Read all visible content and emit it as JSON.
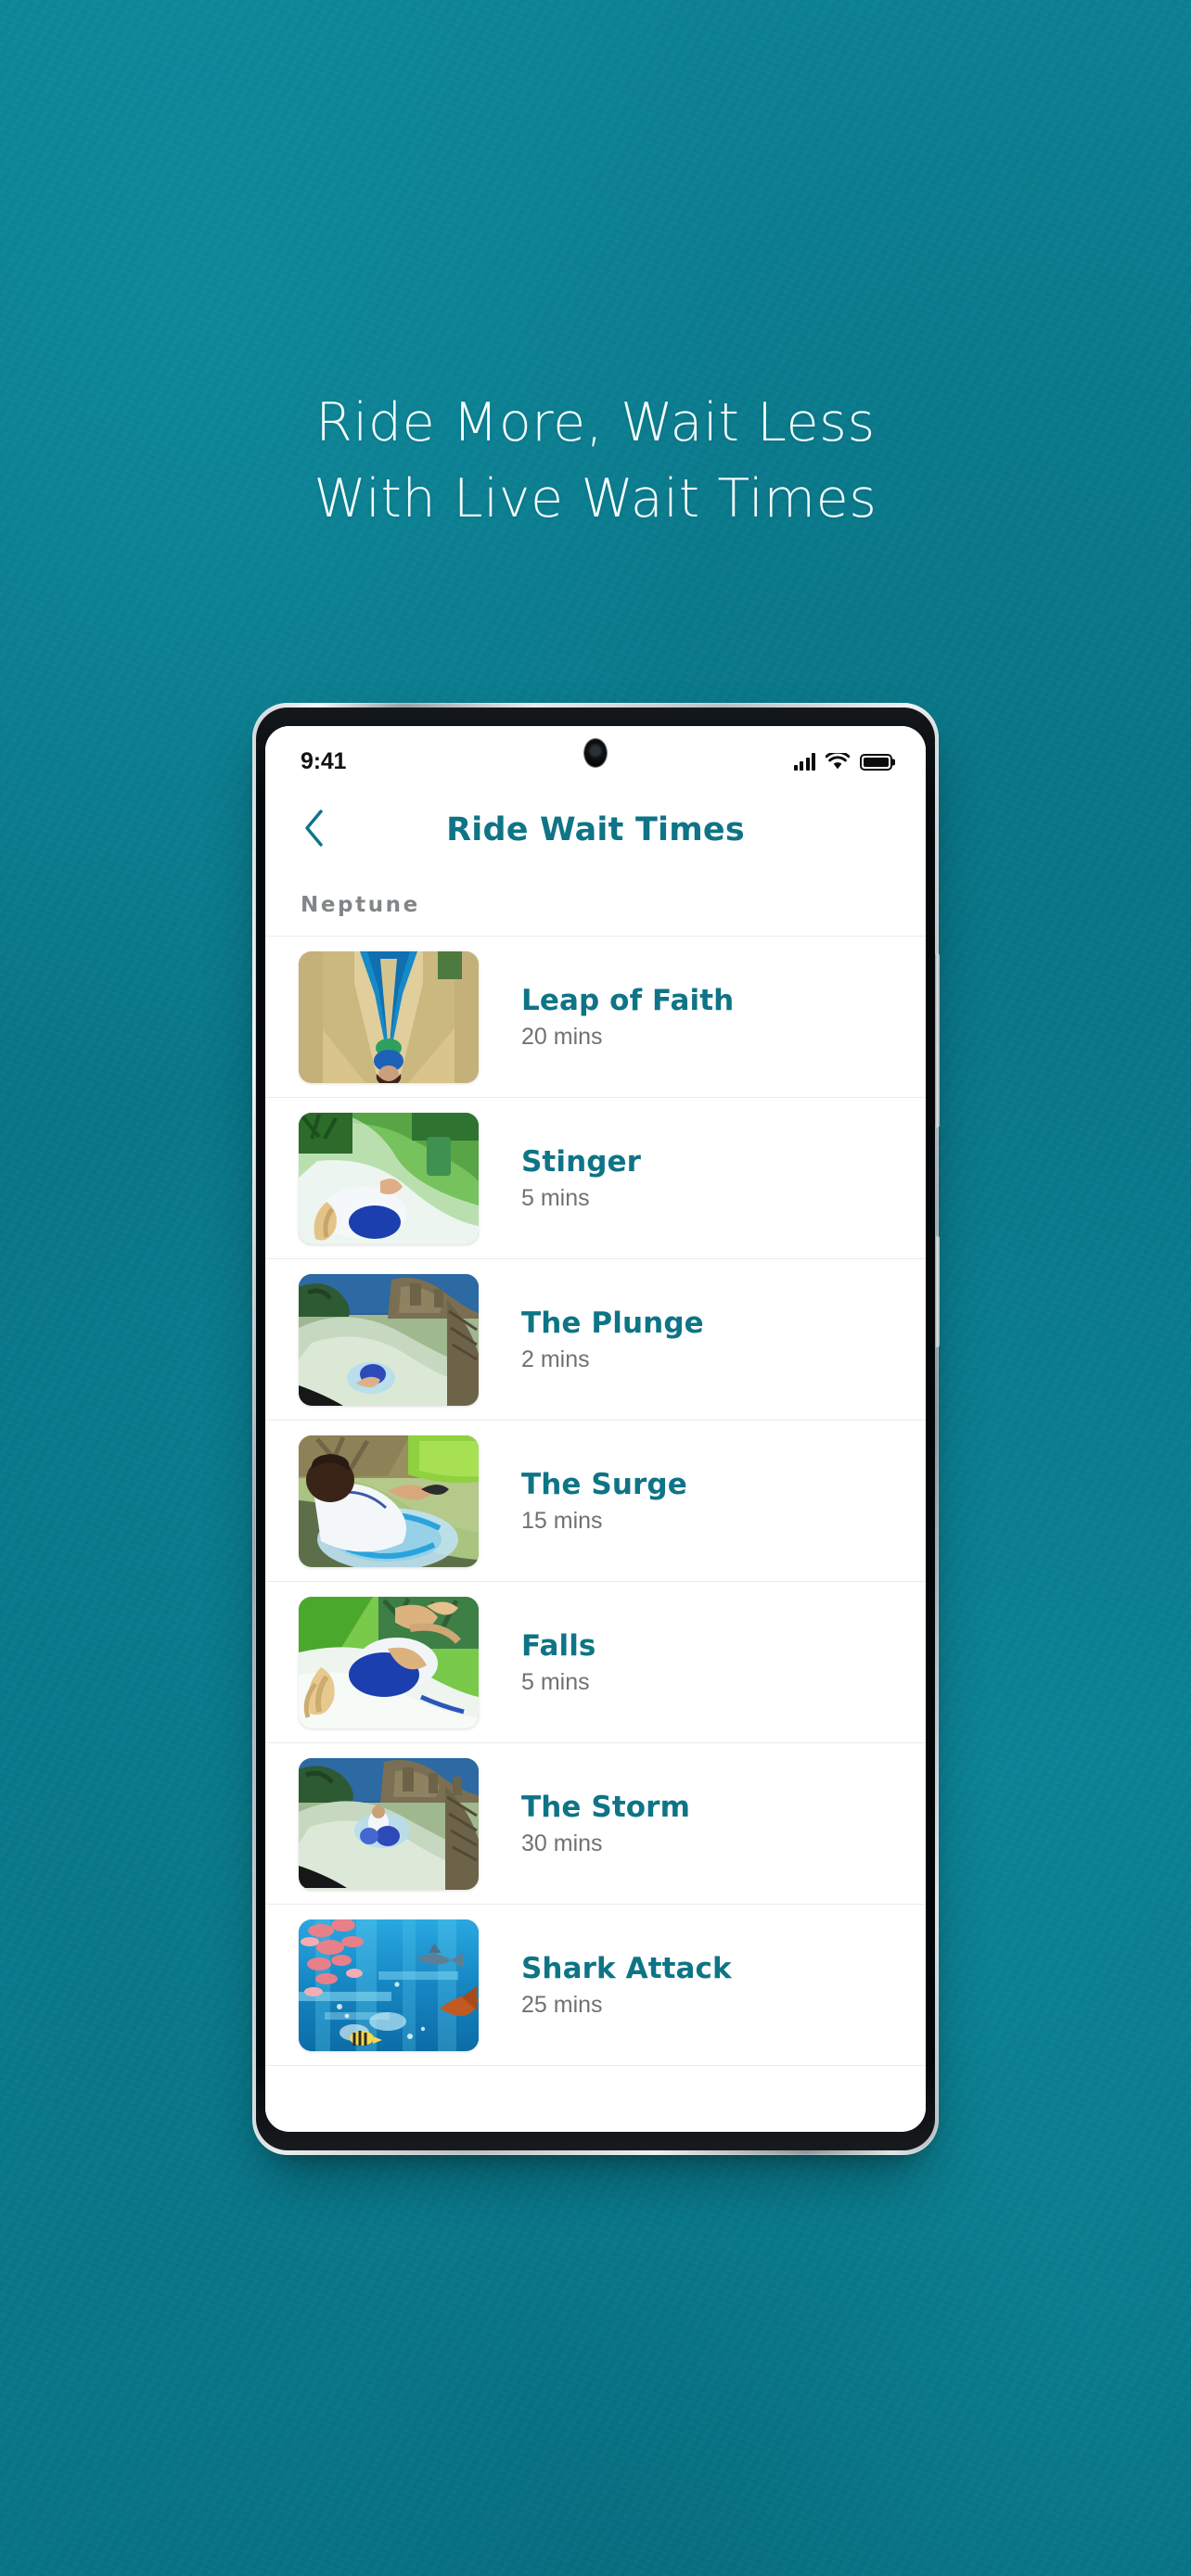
{
  "promo": {
    "headline_line1": "Ride More, Wait Less",
    "headline_line2": "With Live Wait Times",
    "background_color": "#0b7d8f",
    "headline_color": "#f2fbfc"
  },
  "status_bar": {
    "time": "9:41",
    "signal_icon": "cellular-signal-icon",
    "signal_bars": 4,
    "wifi_icon": "wifi-icon",
    "battery_icon": "battery-full-icon",
    "battery_level": 100
  },
  "header": {
    "title": "Ride Wait Times",
    "back_icon": "chevron-left-icon",
    "accent_color": "#0e7486"
  },
  "section": {
    "label": "Neptune"
  },
  "rides": [
    {
      "name": "Leap of Faith",
      "wait": "20 mins",
      "thumb": "leap-of-faith-thumbnail"
    },
    {
      "name": "Stinger",
      "wait": "5 mins",
      "thumb": "stinger-thumbnail"
    },
    {
      "name": "The Plunge",
      "wait": "2 mins",
      "thumb": "the-plunge-thumbnail"
    },
    {
      "name": "The Surge",
      "wait": "15 mins",
      "thumb": "the-surge-thumbnail"
    },
    {
      "name": "Falls",
      "wait": "5 mins",
      "thumb": "falls-thumbnail"
    },
    {
      "name": "The Storm",
      "wait": "30 mins",
      "thumb": "the-storm-thumbnail"
    },
    {
      "name": "Shark Attack",
      "wait": "25 mins",
      "thumb": "shark-attack-thumbnail"
    }
  ],
  "device": {
    "camera": "punch-hole-camera",
    "volume_button": "volume-rocker-button",
    "power_button": "power-button"
  }
}
